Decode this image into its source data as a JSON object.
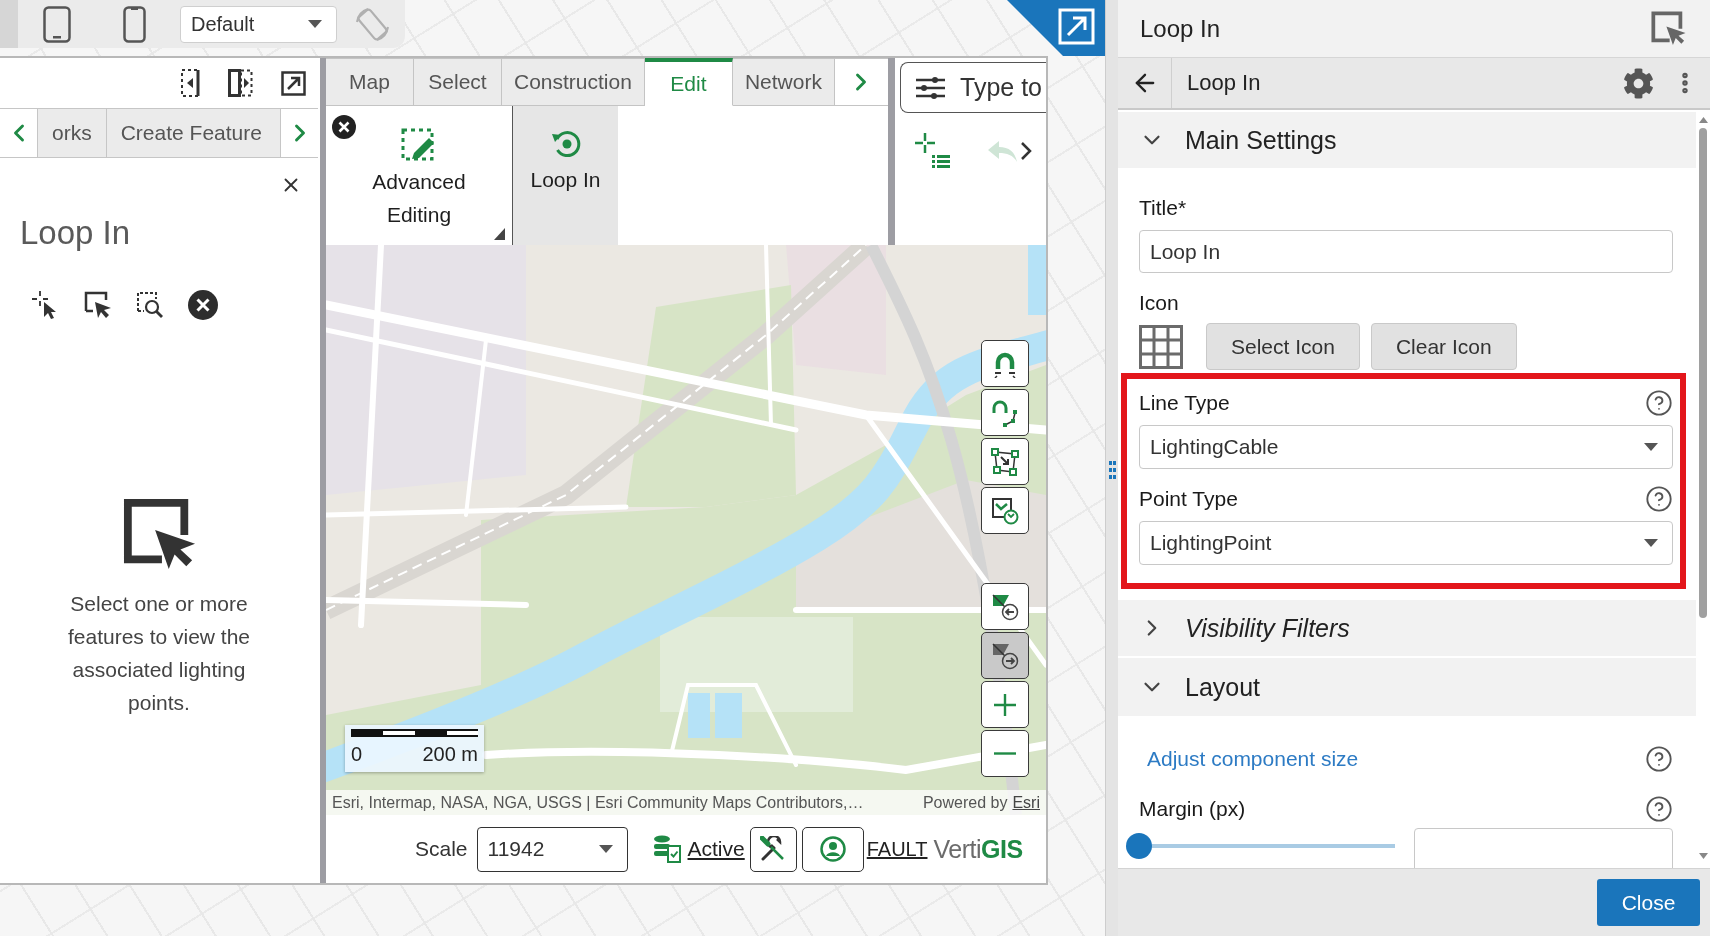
{
  "device_toolbar": {
    "layout_select": "Default"
  },
  "left_panel": {
    "tabs": [
      {
        "label": "orks",
        "selected": false
      },
      {
        "label": "Create Feature",
        "selected": false
      }
    ],
    "title": "Loop In",
    "message": "Select one or more features to view the associated lighting points."
  },
  "ribbon": {
    "tabs": [
      {
        "label": "Map",
        "selected": false
      },
      {
        "label": "Select",
        "selected": false
      },
      {
        "label": "Construction",
        "selected": false
      },
      {
        "label": "Edit",
        "selected": true
      },
      {
        "label": "Network",
        "selected": false
      }
    ],
    "tools": [
      {
        "kind": "advanced",
        "label": "Advanced Editing",
        "selected": false
      },
      {
        "kind": "loop",
        "label": "Loop In",
        "selected": true
      }
    ],
    "search": {
      "placeholder": "Type to"
    }
  },
  "map": {
    "controls": [
      {
        "kind": "snap",
        "disabled": false
      },
      {
        "kind": "snap-vertex",
        "disabled": false
      },
      {
        "kind": "reshape",
        "disabled": false
      },
      {
        "kind": "replace",
        "disabled": false
      },
      {
        "kind": "undo-feature",
        "disabled": false
      },
      {
        "kind": "redo-feature",
        "disabled": true
      },
      {
        "kind": "zoom-in",
        "disabled": false
      },
      {
        "kind": "zoom-out",
        "disabled": false
      }
    ],
    "scale_bar": {
      "start": "0",
      "end": "200 m"
    },
    "attribution": "Esri, Intermap, NASA, NGA, USGS | Esri Community Maps Contributors,…",
    "powered_by": "Powered by",
    "powered_link": "Esri"
  },
  "status_bar": {
    "scale_label": "Scale",
    "scale_value": "11942",
    "active_link": "Active",
    "fault_link": "FAULT",
    "logo": {
      "prefix": "Verti",
      "suffix": "GIS"
    }
  },
  "settings_panel": {
    "header_title": "Loop In",
    "breadcrumb": "Loop In",
    "main_settings": {
      "title": "Main Settings",
      "expanded": true,
      "title_field": {
        "label": "Title*",
        "value": "Loop In"
      },
      "icon_field": {
        "label": "Icon",
        "buttons": [
          "Select Icon",
          "Clear Icon"
        ]
      },
      "type_fields": {
        "highlighted": true,
        "items": [
          {
            "label": "Line Type",
            "value": "LightingCable"
          },
          {
            "label": "Point Type",
            "value": "LightingPoint"
          }
        ]
      }
    },
    "visibility_filters": {
      "title": "Visibility Filters",
      "expanded": false
    },
    "layout": {
      "title": "Layout",
      "expanded": true,
      "size_link": "Adjust component size",
      "margin": {
        "label": "Margin (px)",
        "level": 0
      }
    },
    "close_button": "Close"
  }
}
